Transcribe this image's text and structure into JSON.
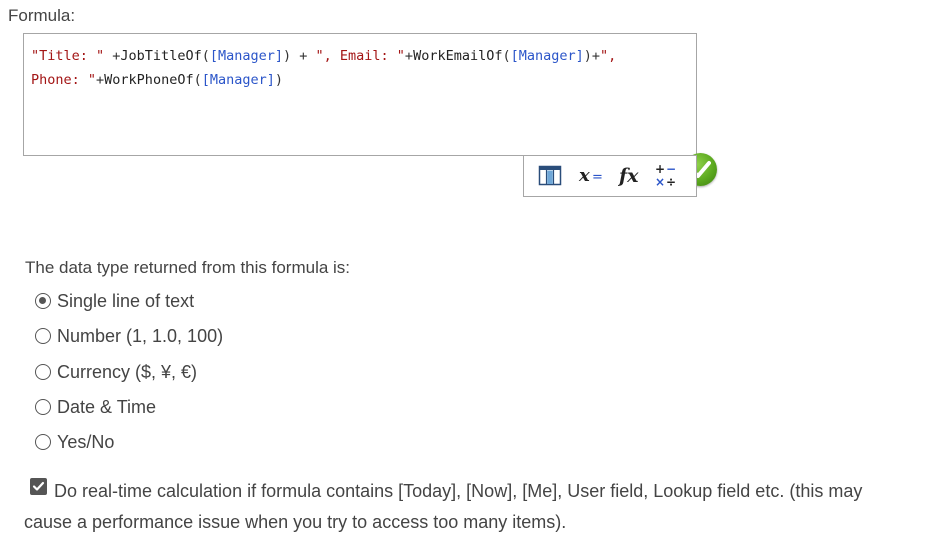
{
  "formula": {
    "label": "Formula:",
    "tokens": [
      {
        "t": "\"Title: \"",
        "k": "str"
      },
      {
        "t": " +",
        "k": "op"
      },
      {
        "t": "JobTitleOf",
        "k": "fn"
      },
      {
        "t": "(",
        "k": "op"
      },
      {
        "t": "[Manager]",
        "k": "fld"
      },
      {
        "t": ") + ",
        "k": "op"
      },
      {
        "t": "\", Email: \"",
        "k": "str"
      },
      {
        "t": "+",
        "k": "op"
      },
      {
        "t": "WorkEmailOf",
        "k": "fn"
      },
      {
        "t": "(",
        "k": "op"
      },
      {
        "t": "[Manager]",
        "k": "fld"
      },
      {
        "t": ")+",
        "k": "op"
      },
      {
        "t": "\",\nPhone: \"",
        "k": "str"
      },
      {
        "t": "+",
        "k": "op"
      },
      {
        "t": "WorkPhoneOf",
        "k": "fn"
      },
      {
        "t": "(",
        "k": "op"
      },
      {
        "t": "[Manager]",
        "k": "fld"
      },
      {
        "t": ")",
        "k": "op"
      }
    ],
    "status_icon": "check-circle-icon",
    "toolbar": [
      {
        "name": "insert-column-icon"
      },
      {
        "name": "variable-icon"
      },
      {
        "name": "function-icon"
      },
      {
        "name": "operators-icon"
      }
    ]
  },
  "data_type": {
    "label": "The data type returned from this formula is:",
    "options": [
      {
        "label": "Single line of text",
        "checked": true
      },
      {
        "label": "Number (1, 1.0, 100)",
        "checked": false
      },
      {
        "label": "Currency ($, ¥, €)",
        "checked": false
      },
      {
        "label": "Date & Time",
        "checked": false
      },
      {
        "label": "Yes/No",
        "checked": false
      }
    ]
  },
  "realtime": {
    "checked": true,
    "line1": "Do real-time calculation if formula contains [Today], [Now], [Me], User field, Lookup field etc. (this may",
    "line2": "cause a performance issue when you try to access too many items)."
  },
  "colors": {
    "string": "#a31515",
    "field": "#2b55c9",
    "check": "#5ca91f"
  }
}
